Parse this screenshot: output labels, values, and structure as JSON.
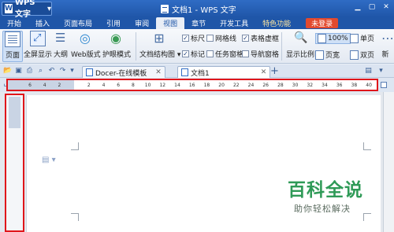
{
  "app": {
    "menu_label": "WPS 文字",
    "logo_letter": "W",
    "window_title": "文档1 - WPS 文字",
    "window_controls": [
      "▁",
      "▢",
      "✕"
    ]
  },
  "menu": {
    "tabs": [
      "开始",
      "插入",
      "页面布局",
      "引用",
      "审阅",
      "视图",
      "章节",
      "开发工具",
      "特色功能"
    ],
    "active_tab": "视图",
    "login_label": "未登录"
  },
  "ribbon": {
    "view_buttons": [
      "页面",
      "全屏显示",
      "大纲",
      "Web版式",
      "护眼模式"
    ],
    "doc_structure_label": "文档结构图",
    "checkboxes": [
      {
        "label": "标尺",
        "checked": true
      },
      {
        "label": "网格线",
        "checked": false
      },
      {
        "label": "表格虚框",
        "checked": true
      },
      {
        "label": "标记",
        "checked": true
      },
      {
        "label": "任务窗格",
        "checked": false
      },
      {
        "label": "导航窗格",
        "checked": false
      }
    ],
    "zoom_label": "显示比例",
    "zoom_value": "100%",
    "page_width_label": "页宽",
    "single_page_label": "单页",
    "double_page_label": "双页",
    "new_label": "新"
  },
  "tabs": {
    "docer_tab": "Docer-在线模板",
    "doc_tab": "文档1",
    "add_label": "+"
  },
  "ruler": {
    "ticks": [
      "6",
      "4",
      "2",
      "",
      "2",
      "4",
      "6",
      "8",
      "10",
      "12",
      "14",
      "16",
      "18",
      "20",
      "22",
      "24",
      "26",
      "28",
      "30",
      "32",
      "34",
      "36",
      "38",
      "40"
    ]
  },
  "watermark": {
    "title": "百科全说",
    "subtitle": "助你轻松解决"
  },
  "colors": {
    "brand_blue": "#1f56a8",
    "highlight_red": "#e0161b",
    "login_orange": "#e24a2e",
    "watermark_green": "#2f9a57"
  }
}
